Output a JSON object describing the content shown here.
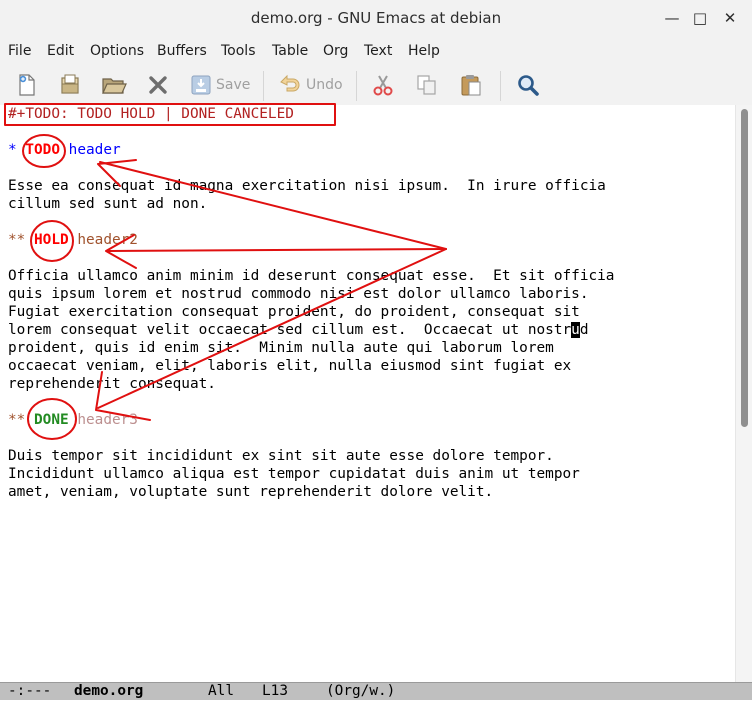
{
  "window": {
    "title": "demo.org - GNU Emacs at debian",
    "minimize": "—",
    "maximize": "□",
    "close": "✕"
  },
  "menubar": {
    "items": [
      "File",
      "Edit",
      "Options",
      "Buffers",
      "Tools",
      "Table",
      "Org",
      "Text",
      "Help"
    ]
  },
  "toolbar": {
    "save_label": "Save",
    "undo_label": "Undo",
    "icons": [
      "new-file-icon",
      "open-file-icon",
      "open-folder-icon",
      "close-icon",
      "save-icon",
      "undo-icon",
      "cut-icon",
      "copy-icon",
      "paste-icon",
      "search-icon"
    ]
  },
  "buffer": {
    "todo_keywords_line": "#+TODO: TODO HOLD | DONE CANCELED",
    "heading1": {
      "stars": "*",
      "keyword": "TODO",
      "title": "header"
    },
    "para1": [
      "Esse ea consequat id magna exercitation nisi ipsum.  In irure officia",
      "cillum sed sunt ad non."
    ],
    "heading2": {
      "stars": "**",
      "keyword": "HOLD",
      "title": "header2"
    },
    "para2": [
      "Officia ullamco anim minim id deserunt consequat esse.  Et sit officia",
      "quis ipsum lorem et nostrud commodo nisi est dolor ullamco laboris.",
      "Fugiat exercitation consequat proident, do proident, consequat sit",
      "lorem consequat velit occaecat sed cillum est.  Occaecat ut nostr",
      "u",
      "d",
      "proident, quis id enim sit.  Minim nulla aute qui laborum lorem",
      "occaecat veniam, elit, laboris elit, nulla eiusmod sint fugiat ex",
      "reprehenderit consequat."
    ],
    "heading3": {
      "stars": "**",
      "keyword": "DONE",
      "title": "header3"
    },
    "para3": [
      "Duis tempor sit incididunt ex sint sit aute esse dolore tempor.",
      "Incididunt ullamco aliqua est tempor cupidatat duis anim ut tempor",
      "amet, veniam, voluptate sunt reprehenderit dolore velit."
    ]
  },
  "modeline": {
    "status": "-:---",
    "buffer_name": "demo.org",
    "position": "All",
    "line": "L13",
    "modes": "(Org/w.)"
  },
  "colors": {
    "todo": "#ff0000",
    "hold": "#ff0000",
    "done": "#228b22",
    "annotation": "#e01010"
  }
}
